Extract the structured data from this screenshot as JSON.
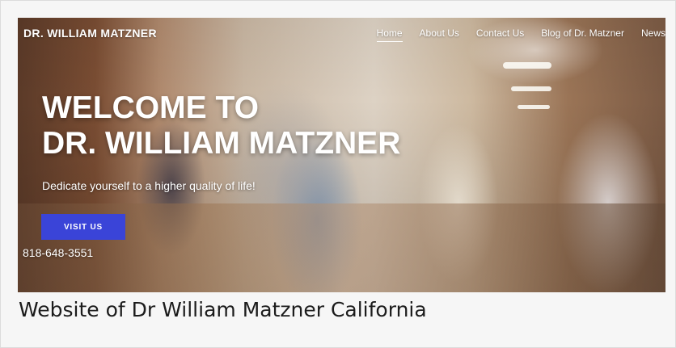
{
  "site": {
    "brand": "DR. WILLIAM MATZNER"
  },
  "nav": {
    "items": [
      {
        "label": "Home",
        "active": true
      },
      {
        "label": "About Us",
        "active": false
      },
      {
        "label": "Contact Us",
        "active": false
      },
      {
        "label": "Blog of Dr. Matzner",
        "active": false
      },
      {
        "label": "News",
        "active": false
      }
    ]
  },
  "hero": {
    "headline_line1": "WELCOME TO",
    "headline_line2": "DR. WILLIAM MATZNER",
    "tagline": "Dedicate yourself to a higher quality of life!",
    "button_label": "VISIT US",
    "phone": "818-648-3551",
    "accent_color": "#3a44d8"
  },
  "caption": {
    "text": "Website of Dr William Matzner California"
  }
}
